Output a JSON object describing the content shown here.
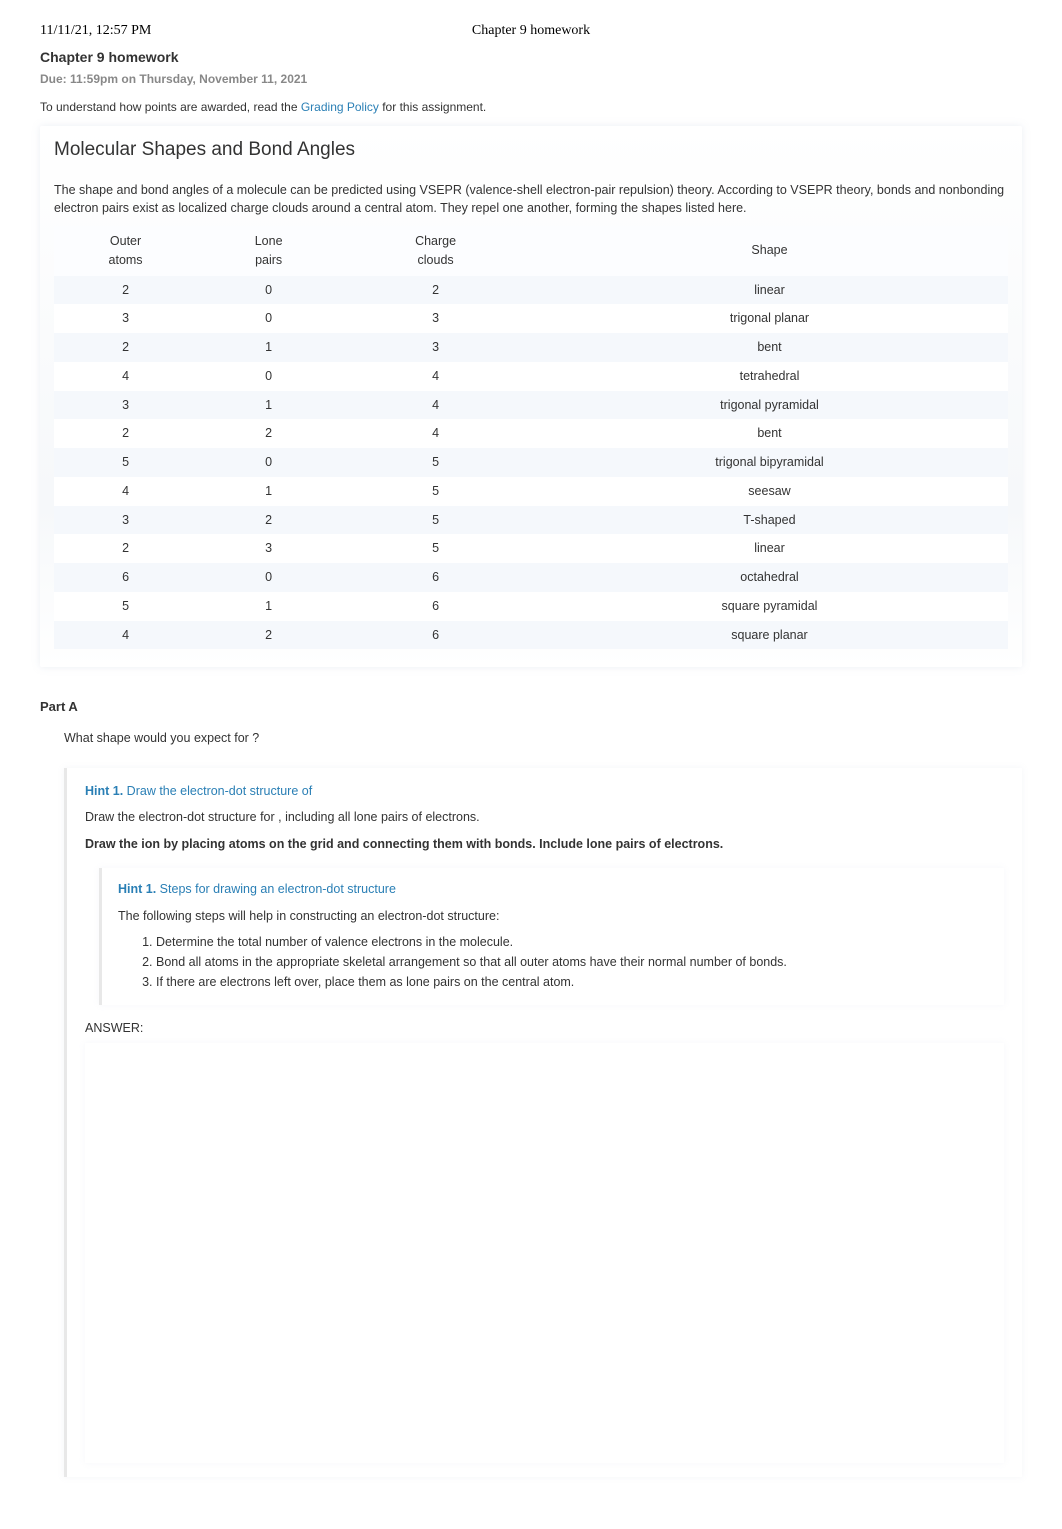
{
  "header": {
    "timestamp": "11/11/21, 12:57 PM",
    "center": "Chapter 9 homework"
  },
  "assignment": {
    "title": "Chapter 9 homework",
    "due": "Due: 11:59pm on Thursday, November 11, 2021",
    "points_prefix": "To understand how points are awarded, read the ",
    "points_link": "Grading Policy",
    "points_suffix": " for this assignment."
  },
  "section": {
    "title": "Molecular Shapes and Bond Angles",
    "intro": "The shape and bond angles of a molecule can be predicted using VSEPR (valence-shell electron-pair repulsion) theory. According to VSEPR theory, bonds and nonbonding electron pairs exist as localized charge clouds around a central atom. They repel one another, forming the shapes listed here.",
    "table": {
      "headers": {
        "outer1": "Outer",
        "outer2": "atoms",
        "lone1": "Lone",
        "lone2": "pairs",
        "charge1": "Charge",
        "charge2": "clouds",
        "shape": "Shape"
      },
      "rows": [
        {
          "outer": "2",
          "lone": "0",
          "charge": "2",
          "shape": "linear"
        },
        {
          "outer": "3",
          "lone": "0",
          "charge": "3",
          "shape": "trigonal planar"
        },
        {
          "outer": "2",
          "lone": "1",
          "charge": "3",
          "shape": "bent"
        },
        {
          "outer": "4",
          "lone": "0",
          "charge": "4",
          "shape": "tetrahedral"
        },
        {
          "outer": "3",
          "lone": "1",
          "charge": "4",
          "shape": "trigonal pyramidal"
        },
        {
          "outer": "2",
          "lone": "2",
          "charge": "4",
          "shape": "bent"
        },
        {
          "outer": "5",
          "lone": "0",
          "charge": "5",
          "shape": "trigonal bipyramidal"
        },
        {
          "outer": "4",
          "lone": "1",
          "charge": "5",
          "shape": "seesaw"
        },
        {
          "outer": "3",
          "lone": "2",
          "charge": "5",
          "shape": "T-shaped"
        },
        {
          "outer": "2",
          "lone": "3",
          "charge": "5",
          "shape": "linear"
        },
        {
          "outer": "6",
          "lone": "0",
          "charge": "6",
          "shape": "octahedral"
        },
        {
          "outer": "5",
          "lone": "1",
          "charge": "6",
          "shape": "square pyramidal"
        },
        {
          "outer": "4",
          "lone": "2",
          "charge": "6",
          "shape": "square planar"
        }
      ]
    }
  },
  "partA": {
    "label": "Part A",
    "question": "What shape would you expect for ?",
    "hint1": {
      "num": "Hint 1.",
      "title": " Draw the electron-dot structure of ",
      "p1": "Draw the electron-dot structure for , including all lone pairs of electrons.",
      "bold": "Draw the ion by placing atoms on the grid and connecting them with bonds. Include lone pairs of electrons."
    },
    "hint1_inner": {
      "num": "Hint 1.",
      "title": " Steps for drawing an electron-dot structure",
      "p1": "The following steps will help in constructing an electron-dot structure:",
      "steps": [
        "Determine the total number of valence electrons in the molecule.",
        "Bond all atoms in the appropriate skeletal arrangement so that all outer atoms have their normal number of bonds.",
        "If there are electrons left over, place them as lone pairs on the central atom."
      ]
    },
    "answer_label": "ANSWER:"
  }
}
